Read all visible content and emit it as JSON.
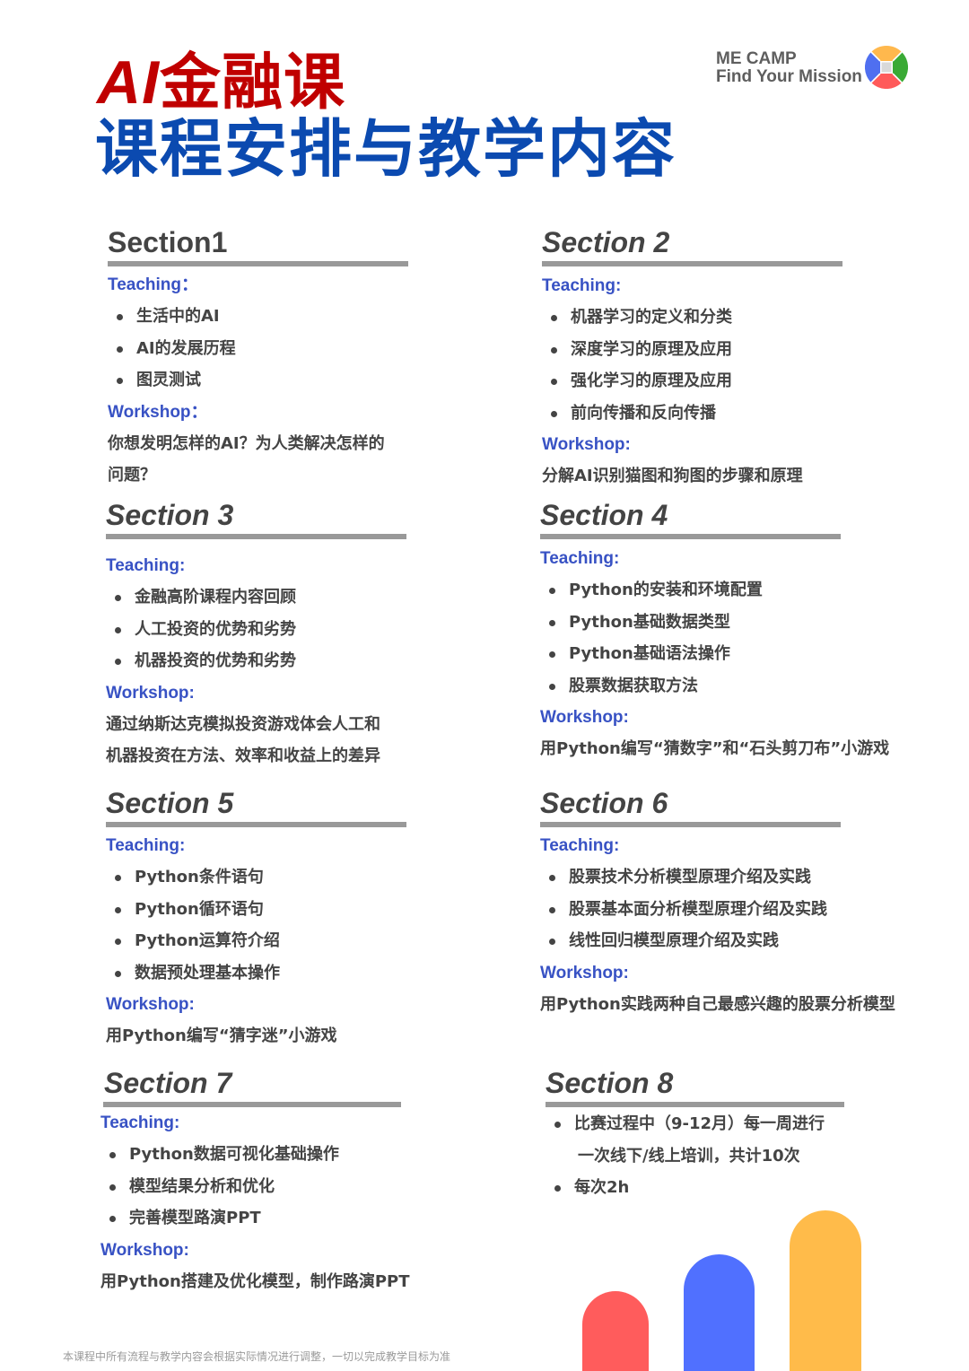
{
  "header": {
    "title_ai": "AI",
    "title_rest": "金融课",
    "subtitle": "课程安排与教学内容"
  },
  "brand": {
    "line1": "ME CAMP",
    "line2": "Find Your Mission",
    "logo_colors": {
      "top": "#ffb84d",
      "right": "#3aaa35",
      "bottom": "#ff5a5a",
      "left": "#4f6ff0",
      "center": "#d9d9d9"
    }
  },
  "colors": {
    "title_red": "#c00000",
    "title_blue": "#0b4ab0",
    "label_blue": "#3852c4",
    "text_gray": "#444444",
    "rule_gray": "#999999"
  },
  "sections": [
    {
      "title": "Section1",
      "teaching_label": "Teaching：",
      "teaching": [
        "生活中的AI",
        "AI的发展历程",
        "图灵测试"
      ],
      "workshop_label": "Workshop：",
      "workshop": [
        "你想发明怎样的AI？为人类解决怎样的",
        "问题？"
      ]
    },
    {
      "title": "Section 2",
      "teaching_label": "Teaching:",
      "teaching": [
        "机器学习的定义和分类",
        "深度学习的原理及应用",
        "强化学习的原理及应用",
        "前向传播和反向传播"
      ],
      "workshop_label": "Workshop:",
      "workshop": [
        "分解AI识别猫图和狗图的步骤和原理"
      ]
    },
    {
      "title": "Section 3",
      "teaching_label": "Teaching:",
      "teaching": [
        "金融高阶课程内容回顾",
        "人工投资的优势和劣势",
        "机器投资的优势和劣势"
      ],
      "workshop_label": "Workshop:",
      "workshop": [
        "通过纳斯达克模拟投资游戏体会人工和",
        "机器投资在方法、效率和收益上的差异"
      ]
    },
    {
      "title": "Section 4",
      "teaching_label": "Teaching:",
      "teaching": [
        "Python的安装和环境配置",
        "Python基础数据类型",
        "Python基础语法操作",
        "股票数据获取方法"
      ],
      "workshop_label": "Workshop:",
      "workshop": [
        "用Python编写“猜数字”和“石头剪刀布”小游戏"
      ]
    },
    {
      "title": "Section 5",
      "teaching_label": "Teaching:",
      "teaching": [
        "Python条件语句",
        "Python循环语句",
        "Python运算符介绍",
        "数据预处理基本操作"
      ],
      "workshop_label": "Workshop:",
      "workshop": [
        "用Python编写“猜字迷”小游戏"
      ]
    },
    {
      "title": "Section 6",
      "teaching_label": "Teaching:",
      "teaching": [
        "股票技术分析模型原理介绍及实践",
        "股票基本面分析模型原理介绍及实践",
        "线性回归模型原理介绍及实践"
      ],
      "workshop_label": "Workshop:",
      "workshop": [
        "用Python实践两种自己最感兴趣的股票分析模型"
      ]
    },
    {
      "title": "Section 7",
      "teaching_label": "Teaching:",
      "teaching": [
        "Python数据可视化基础操作",
        "模型结果分析和优化",
        "完善模型路演PPT"
      ],
      "workshop_label": "Workshop:",
      "workshop": [
        "用Python搭建及优化模型，制作路演PPT"
      ]
    },
    {
      "title": "Section 8",
      "items": [
        "比赛过程中（9-12月）每一周进行",
        "一次线下/线上培训，共计10次",
        "每次2h"
      ]
    }
  ],
  "footer": {
    "note": "本课程中所有流程与教学内容会根据实际情况进行调整，一切以完成教学目标为准"
  },
  "decoration": {
    "bars": [
      {
        "color": "#ff5c5c"
      },
      {
        "color": "#5070ff"
      },
      {
        "color": "#ffbb4a"
      }
    ]
  }
}
